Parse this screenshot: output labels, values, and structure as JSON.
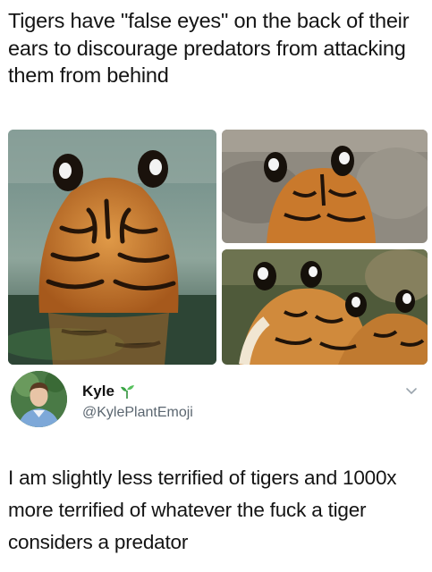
{
  "caption": "Tigers have \"false eyes\" on the back of their ears to discourage predators from attacking them from behind",
  "photos": [
    {
      "icon": "tiger-back-in-water-photo"
    },
    {
      "icon": "tiger-head-back-photo"
    },
    {
      "icon": "tigers-lying-photo"
    }
  ],
  "tweet": {
    "name": "Kyle",
    "name_emoji": "seedling-icon",
    "handle": "@KylePlantEmoji",
    "text": "I am slightly less terrified of tigers and 1000x more terrified of whatever the fuck a tiger considers a predator"
  },
  "colors": {
    "text": "#141414",
    "handle": "#5b6670",
    "tiger_orange": "#c8782a",
    "sprout_green": "#3aa445"
  }
}
